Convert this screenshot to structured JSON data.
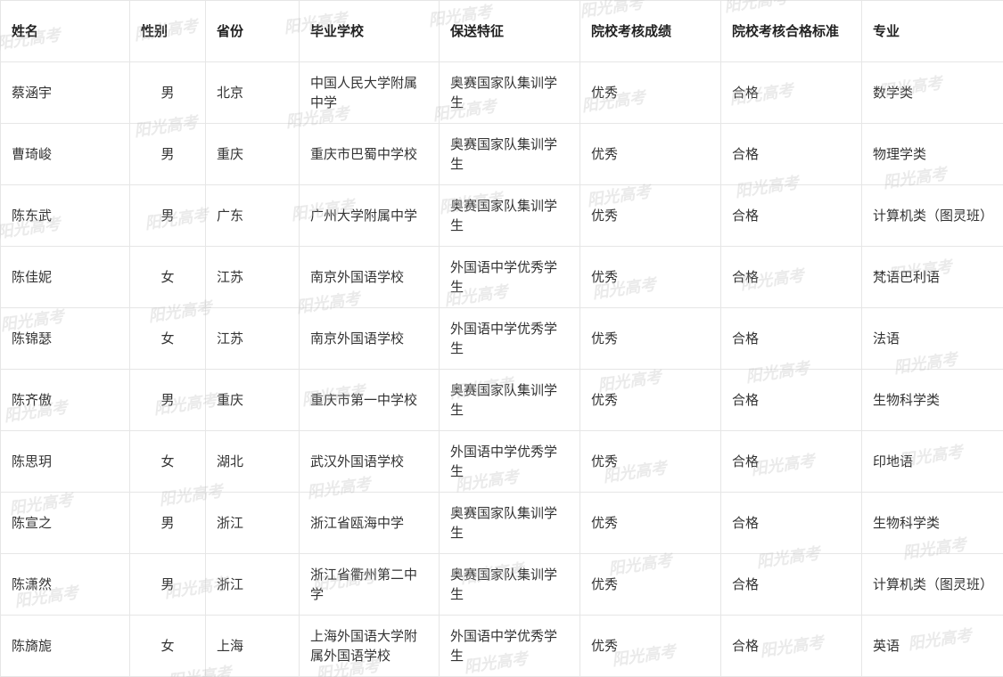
{
  "table": {
    "headers": [
      "姓名",
      "性别",
      "省份",
      "毕业学校",
      "保送特征",
      "院校考核成绩",
      "院校考核合格标准",
      "专业"
    ],
    "rows": [
      [
        "蔡涵宇",
        "男",
        "北京",
        "中国人民大学附属中学",
        "奥赛国家队集训学生",
        "优秀",
        "合格",
        "数学类"
      ],
      [
        "曹琦峻",
        "男",
        "重庆",
        "重庆市巴蜀中学校",
        "奥赛国家队集训学生",
        "优秀",
        "合格",
        "物理学类"
      ],
      [
        "陈东武",
        "男",
        "广东",
        "广州大学附属中学",
        "奥赛国家队集训学生",
        "优秀",
        "合格",
        "计算机类（图灵班）"
      ],
      [
        "陈佳妮",
        "女",
        "江苏",
        "南京外国语学校",
        "外国语中学优秀学生",
        "优秀",
        "合格",
        "梵语巴利语"
      ],
      [
        "陈锦瑟",
        "女",
        "江苏",
        "南京外国语学校",
        "外国语中学优秀学生",
        "优秀",
        "合格",
        "法语"
      ],
      [
        "陈齐傲",
        "男",
        "重庆",
        "重庆市第一中学校",
        "奥赛国家队集训学生",
        "优秀",
        "合格",
        "生物科学类"
      ],
      [
        "陈思玥",
        "女",
        "湖北",
        "武汉外国语学校",
        "外国语中学优秀学生",
        "优秀",
        "合格",
        "印地语"
      ],
      [
        "陈宣之",
        "男",
        "浙江",
        "浙江省瓯海中学",
        "奥赛国家队集训学生",
        "优秀",
        "合格",
        "生物科学类"
      ],
      [
        "陈潇然",
        "男",
        "浙江",
        "浙江省衢州第二中学",
        "奥赛国家队集训学生",
        "优秀",
        "合格",
        "计算机类（图灵班）"
      ],
      [
        "陈旖旎",
        "女",
        "上海",
        "上海外国语大学附属外国语学校",
        "外国语中学优秀学生",
        "优秀",
        "合格",
        "英语"
      ]
    ]
  },
  "watermark": {
    "text": "阳光高考"
  }
}
